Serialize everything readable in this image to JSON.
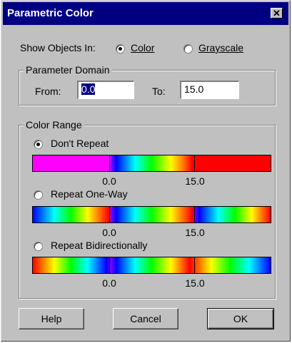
{
  "window": {
    "title": "Parametric Color",
    "close_label": "✕"
  },
  "show_objects": {
    "label": "Show Objects In:",
    "options": [
      {
        "label": "Color",
        "checked": true
      },
      {
        "label": "Grayscale",
        "checked": false
      }
    ]
  },
  "parameter_domain": {
    "title": "Parameter Domain",
    "from_label": "From:",
    "from_value": "0.0",
    "to_label": "To:",
    "to_value": "15.0"
  },
  "color_range": {
    "title": "Color Range",
    "options": [
      {
        "label": "Don't Repeat",
        "checked": true
      },
      {
        "label": "Repeat One-Way",
        "checked": false
      },
      {
        "label": "Repeat Bidirectionally",
        "checked": false
      }
    ],
    "tick_low": "0.0",
    "tick_high": "15.0"
  },
  "buttons": {
    "help": "Help",
    "cancel": "Cancel",
    "ok": "OK"
  }
}
